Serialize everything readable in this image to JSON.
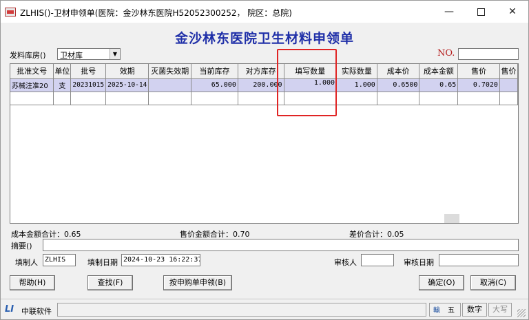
{
  "window": {
    "title": "ZLHIS()-卫材申领单(医院：金沙林东医院H52052300252，  院区：总院)",
    "controls": [
      "minimize-icon",
      "maximize-icon",
      "close-icon"
    ]
  },
  "form": {
    "heading": "金沙林东医院卫生材料申领单",
    "warehouse_label": "发料库房()",
    "warehouse_value": "卫材库",
    "no_label": "NO.",
    "no_value": ""
  },
  "grid": {
    "columns": [
      "批准文号",
      "单位",
      "批号",
      "效期",
      "灭菌失效期",
      "当前库存",
      "对方库存",
      "填写数量",
      "实际数量",
      "成本价",
      "成本金额",
      "售价",
      "售价"
    ],
    "rows": [
      {
        "approval_no": "苏械注准20",
        "unit": "支",
        "batch_no": "20231015",
        "expiry": "2025-10-14",
        "sterile_expiry": "",
        "current_stock": "65.000",
        "other_stock": "200.000",
        "fill_qty": "1.000",
        "actual_qty": "1.000",
        "cost_price": "0.6500",
        "cost_amount": "0.65",
        "sale_price": "0.7020",
        "sale_amount": ""
      }
    ]
  },
  "summary": {
    "cost_total": "成本金额合计：0.65",
    "sale_total": "售价金额合计：0.70",
    "diff_total": "差价合计：0.05"
  },
  "fields": {
    "remark_label": "摘要()",
    "remark_value": "",
    "creator_label": "填制人",
    "creator_value": "ZLHIS",
    "create_date_label": "填制日期",
    "create_date_value": "2024-10-23 16:22:37",
    "auditor_label": "审核人",
    "auditor_value": "",
    "audit_date_label": "审核日期",
    "audit_date_value": ""
  },
  "buttons": {
    "help": "帮助(H)",
    "find": "查找(F)",
    "by_purchase": "按申购单申领(B)",
    "ok": "确定(O)",
    "cancel": "取消(C)"
  },
  "statusbar": {
    "company": "中联软件",
    "ime_icon": "輸",
    "ime_mode": "五",
    "num_lock": "数字",
    "caps_lock": "大写"
  },
  "colors": {
    "heading": "#1f2fa8",
    "selected_row": "#d2d2f0",
    "highlight_box": "#e02424",
    "no_label": "#b52020"
  }
}
